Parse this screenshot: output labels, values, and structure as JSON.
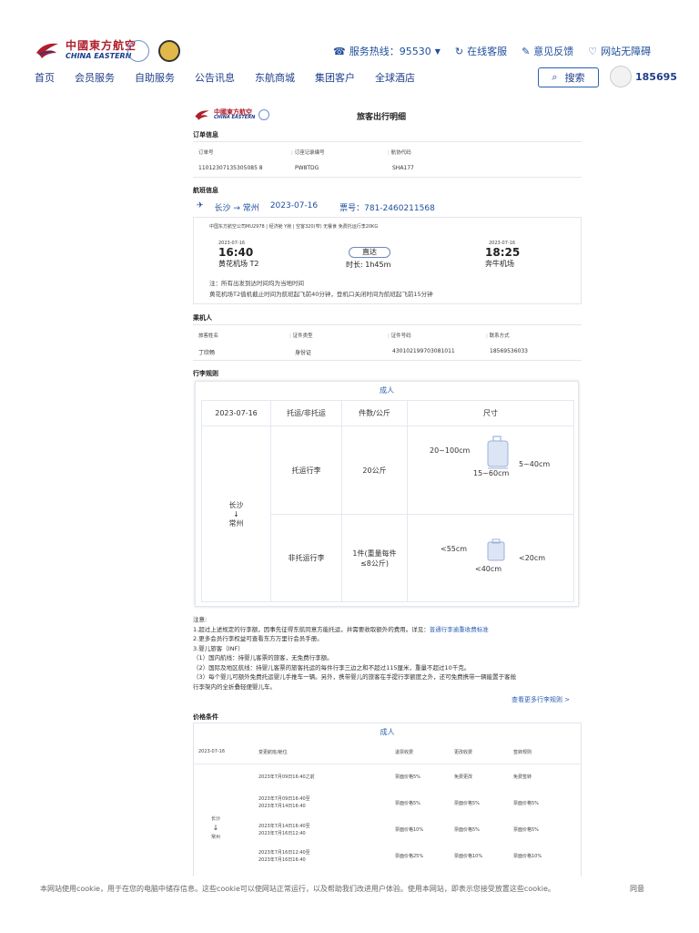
{
  "header": {
    "logo_cn": "中國東方航空",
    "logo_en": "CHINA EASTERN",
    "hotline": "服务热线：95530",
    "online_service": "在线客服",
    "feedback": "意见反馈",
    "accessibility": "网站无障碍",
    "search": "搜索",
    "user_id": "185695",
    "nav": [
      "首页",
      "会员服务",
      "自助服务",
      "公告讯息",
      "东航商城",
      "集团客户",
      "全球酒店"
    ]
  },
  "doc": {
    "title": "旅客出行明细",
    "order_section": "订单信息",
    "order_headers": [
      "订单号",
      "订座记录编号",
      "航协代码"
    ],
    "order_values": [
      "11012307135305085 8",
      "PW8TDG",
      "SHA177"
    ],
    "flight_section": "航班信息",
    "route": "长沙 → 常州",
    "route_date": "2023-07-16",
    "ticket_no": "票号：781-2460211568",
    "flight_detail": "中国东方航空公司MU2978 | 经济舱 Y舱 | 空客320(窄) 无餐食 免费托运行李20KG",
    "dep_date": "2023-07-16",
    "dep_time": "16:40",
    "dep_airport": "黄花机场 T2",
    "direct": "直达",
    "duration": "时长: 1h45m",
    "arr_date": "2023-07-16",
    "arr_time": "18:25",
    "arr_airport": "奔牛机场",
    "note1": "注：所有出发到达时间均为当地时间",
    "note2": "黄花机场T2值机截止时间为航班起飞前40分钟，登机口关闭时间为航班起飞前15分钟",
    "passenger_section": "乘机人",
    "passenger_headers": [
      "旅客姓名",
      "证件类型",
      "证件号码",
      "联系方式"
    ],
    "passenger_values": [
      "丁欣畅",
      "身份证",
      "430102199703081011",
      "18569536033"
    ],
    "luggage_section": "行李规则",
    "adult": "成人",
    "lug_headers": [
      "2023-07-16",
      "托运/非托运",
      "件数/公斤",
      "尺寸"
    ],
    "lug_route_from": "长沙",
    "lug_route_arrow": "↓",
    "lug_route_to": "常州",
    "checked": "托运行李",
    "checked_weight": "20公斤",
    "checked_dims": [
      "20~100cm",
      "5~40cm",
      "15~60cm"
    ],
    "carry": "非托运行李",
    "carry_weight_1": "1件(重量每件",
    "carry_weight_2": "≤8公斤)",
    "carry_dims": [
      "<55cm",
      "<20cm",
      "<40cm"
    ],
    "notes_title": "注意:",
    "notes": [
      "1.超过上述规定的行李额，因事先征得东航同意方能托运，并需要收取额外的费用。详见：",
      "2.更多会员行李权益可查看东方万里行会员手册。",
      "3.婴儿旅客（INF）",
      "（1）国内航线：持婴儿客票的旅客，无免费行李额。",
      "（2）国际及地区航线：持婴儿客票的旅客托运的每件行李三边之和不超过115厘米，重量不超过10千克。",
      "（3）每个婴儿可额外免费托运婴儿手推车一辆。另外，携带婴儿的旅客在手提行李额度之外，还可免费携带一辆能置于客舱",
      "行李架内的全折叠轻便婴儿车。"
    ],
    "notes_link": "普通行李逾重收费标准",
    "more_rules": "查看更多行李规则 >",
    "price_section": "价格条件",
    "price_headers": [
      "2023-07-16",
      "变更航班/舱位",
      "退票收费",
      "更改收费",
      "签转规则"
    ],
    "price_route_from": "长沙",
    "price_route_arrow": "↓",
    "price_route_to": "常州",
    "price_rows": [
      {
        "time": [
          "2023年7月09日16:40之前"
        ],
        "refund": "票面价格5%",
        "change": "免费更改",
        "endorse": "免费签转"
      },
      {
        "time": [
          "2023年7月09日16:40至",
          "2023年7月14日16:40"
        ],
        "refund": "票面价格5%",
        "change": "票面价格5%",
        "endorse": "票面价格5%"
      },
      {
        "time": [
          "2023年7月14日16:40至",
          "2023年7月16日12:40"
        ],
        "refund": "票面价格10%",
        "change": "票面价格5%",
        "endorse": "票面价格5%"
      },
      {
        "time": [
          "2023年7月16日12:40至",
          "2023年7月16日16:40"
        ],
        "refund": "票面价格25%",
        "change": "票面价格10%",
        "endorse": "票面价格10%"
      }
    ]
  },
  "cookie": {
    "text": "本网站使用cookie，用于在您的电脑中储存信息。这些cookie可以使网站正常运行，以及帮助我们改进用户体验。使用本网站，即表示您接受放置这些cookie。",
    "agree": "同意"
  },
  "colors": {
    "brand_red": "#b01e2d",
    "brand_blue": "#1f3e8a",
    "link_blue": "#2b5fb3"
  }
}
